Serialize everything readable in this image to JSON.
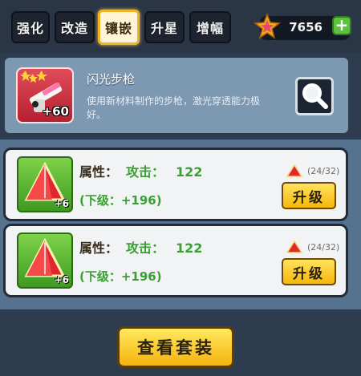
{
  "tabs": [
    {
      "label": "强化",
      "active": false
    },
    {
      "label": "改造",
      "active": false
    },
    {
      "label": "镶嵌",
      "active": true
    },
    {
      "label": "升星",
      "active": false
    },
    {
      "label": "增幅",
      "active": false
    }
  ],
  "currency": {
    "icon": "star-coin-icon",
    "amount": "7656",
    "add_icon": "plus-icon"
  },
  "weapon": {
    "name": "闪光步枪",
    "description": "使用新材料制作的步枪，激光穿透能力极好。",
    "level": "+60",
    "icon": "laser-rifle-icon",
    "stars": 3
  },
  "search_icon": "magnifier-icon",
  "slots": [
    {
      "gem_icon": "red-pyramid-gem-icon",
      "gem_level": "+6",
      "attr_label": "属性：",
      "atk_label": "攻击：",
      "atk_value": "122",
      "next_text": "(下级：+196)",
      "count": "(24/32)",
      "upgrade_label": "升级"
    },
    {
      "gem_icon": "red-pyramid-gem-icon",
      "gem_level": "+6",
      "attr_label": "属性：",
      "atk_label": "攻击：",
      "atk_value": "122",
      "next_text": "(下级：+196)",
      "count": "(24/32)",
      "upgrade_label": "升级"
    }
  ],
  "view_set_label": "查看套装",
  "colors": {
    "accent_yellow": "#f6b30d",
    "attr_green": "#3aa033",
    "panel_blue": "#7d98b1"
  }
}
